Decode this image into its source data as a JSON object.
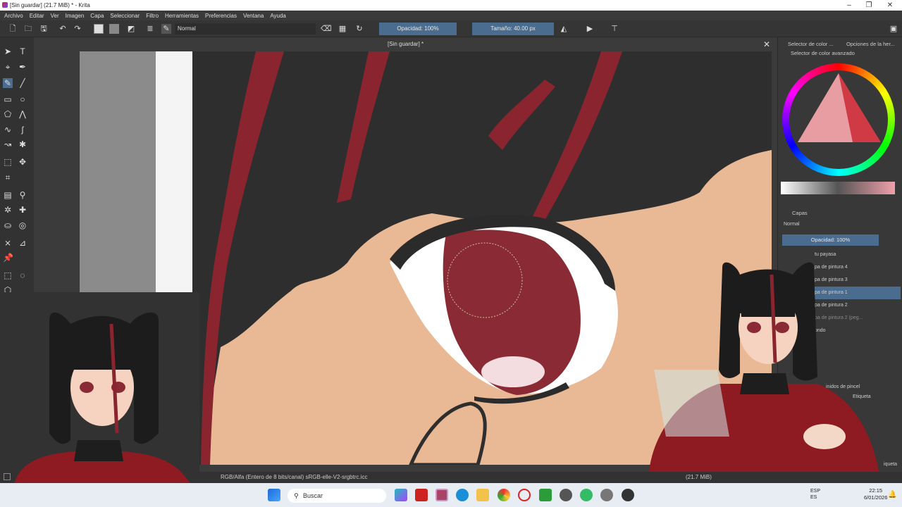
{
  "titlebar": {
    "title": "[Sin guardar] (21.7 MiB) * - Krita"
  },
  "menu": [
    "Archivo",
    "Editar",
    "Ver",
    "Imagen",
    "Capa",
    "Seleccionar",
    "Filtro",
    "Herramientas",
    "Preferencias",
    "Ventana",
    "Ayuda"
  ],
  "toolbar": {
    "blend_mode": "Normal",
    "opacity": "Opacidad: 100%",
    "size": "Tamaño: 40.00 px"
  },
  "document": {
    "tab_title": "[Sin guardar] *"
  },
  "right_panel": {
    "tab_color": "Selector de color ...",
    "tab_options": "Opciones de la her...",
    "advanced_color": "Selector de color avanzado",
    "layers_title": "Capas",
    "layers_blend": "Normal",
    "layers_opacity": "Opacidad: 100%",
    "layers": [
      {
        "name": "tu payasa",
        "selected": false
      },
      {
        "name": "pa de pintura 4",
        "selected": false
      },
      {
        "name": "pa de pintura 3",
        "selected": false
      },
      {
        "name": "pa de pintura 1",
        "selected": true
      },
      {
        "name": "pa de pintura 2",
        "selected": false
      },
      {
        "name": "pa de pintura 2 (peg...",
        "selected": false
      },
      {
        "name": "ondo",
        "selected": false
      }
    ],
    "brushes_title": "inidos de pincel",
    "brushes_tag": "Etiqueta",
    "brushes_tag2": "iqueta"
  },
  "status": {
    "colorspace": "RGB/Alfa (Entero de 8 bits/canal)  sRGB-elle-V2-srgbtrc.icc",
    "mem": "(21.7 MiB)"
  },
  "taskbar": {
    "search": "Buscar",
    "time": "22:15",
    "date": "6/01/2026",
    "lang1": "ESP",
    "lang2": "ES"
  },
  "colors": {
    "accent": "#4a6c8f",
    "hair": "#2e2e2e",
    "red_streak": "#8a2530",
    "skin": "#e9b894",
    "iris": "#8a2a35"
  }
}
